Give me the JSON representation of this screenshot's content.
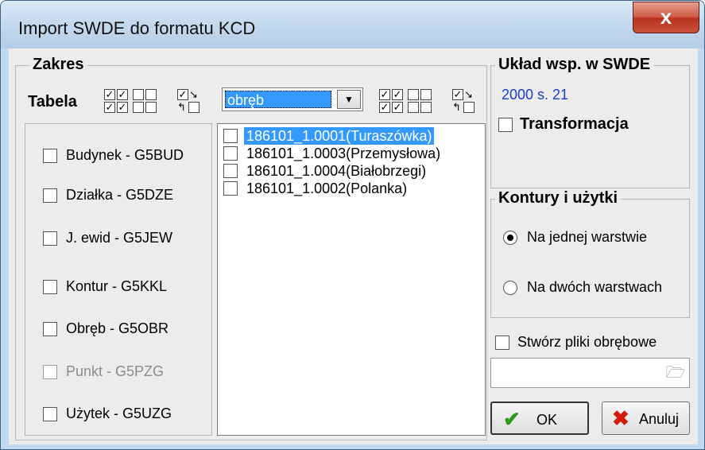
{
  "window": {
    "title": "Import SWDE do formatu KCD",
    "close_label": "x"
  },
  "zakres": {
    "group_title": "Zakres",
    "tabela_label": "Tabela",
    "combo_value": "obręb",
    "combo_arrow": "▼",
    "layers": [
      {
        "label": "Budynek - G5BUD",
        "checked": false,
        "enabled": true
      },
      {
        "label": "Działka - G5DZE",
        "checked": false,
        "enabled": true
      },
      {
        "label": "J. ewid - G5JEW",
        "checked": false,
        "enabled": true
      },
      {
        "label": "Kontur - G5KKL",
        "checked": false,
        "enabled": true
      },
      {
        "label": "Obręb - G5OBR",
        "checked": false,
        "enabled": true
      },
      {
        "label": "Punkt - G5PZG",
        "checked": false,
        "enabled": false
      },
      {
        "label": "Użytek - G5UZG",
        "checked": false,
        "enabled": true
      }
    ],
    "obreby": [
      {
        "label": "186101_1.0001(Turaszówka)",
        "selected": true
      },
      {
        "label": "186101_1.0003(Przemysłowa)",
        "selected": false
      },
      {
        "label": "186101_1.0004(Białobrzegi)",
        "selected": false
      },
      {
        "label": "186101_1.0002(Polanka)",
        "selected": false
      }
    ],
    "mini_check_icon": "✓",
    "arrow_right_icon": "↘",
    "arrow_back_icon": "↰"
  },
  "uklad": {
    "group_title": "Układ wsp. w SWDE",
    "value": "2000 s. 21",
    "transformacja_label": "Transformacja"
  },
  "kontury": {
    "group_title": "Kontury i użytki",
    "options": [
      {
        "label": "Na jednej warstwie",
        "selected": true
      },
      {
        "label": "Na dwóch warstwach",
        "selected": false
      }
    ]
  },
  "stworz_label": "Stwórz pliki obrębowe",
  "folder_icon": "🗁",
  "buttons": {
    "ok_label": "OK",
    "ok_icon": "✔",
    "cancel_label": "Anuluj",
    "cancel_icon": "✖"
  },
  "colors": {
    "ok_icon": "#2f9a1e",
    "cancel_icon": "#d21a0e",
    "selection": "#3399ff"
  }
}
